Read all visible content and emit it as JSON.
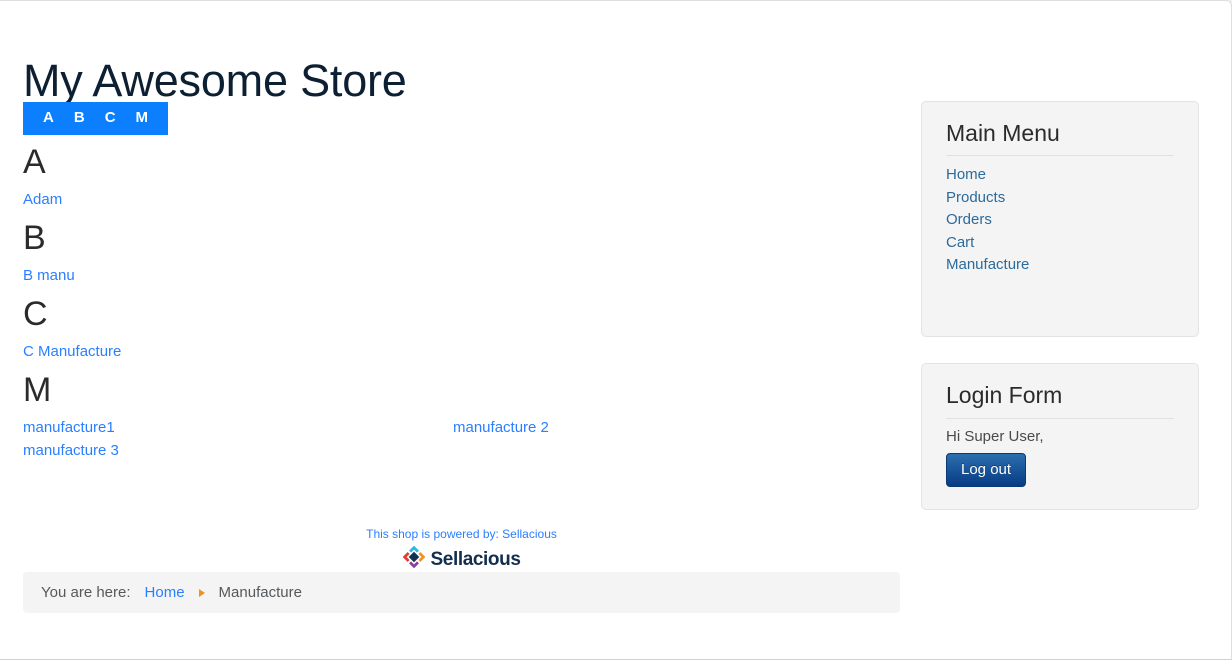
{
  "site": {
    "title": "My Awesome Store"
  },
  "alpha_bar": {
    "letters": [
      {
        "label": "A"
      },
      {
        "label": "B"
      },
      {
        "label": "C"
      },
      {
        "label": "M"
      }
    ]
  },
  "manufacturers": {
    "groups": [
      {
        "letter": "A",
        "items": [
          "Adam"
        ]
      },
      {
        "letter": "B",
        "items": [
          "B manu"
        ]
      },
      {
        "letter": "C",
        "items": [
          "C Manufacture"
        ]
      },
      {
        "letter": "M",
        "items": [
          "manufacture1",
          "manufacture 2",
          "manufacture 3"
        ]
      }
    ]
  },
  "powered_by": {
    "text": "This shop is powered by: Sellacious",
    "brand": "Sellacious",
    "brand_colors": {
      "top": "#2bb8e0",
      "right": "#f2931f",
      "bottom": "#8e3f9e",
      "left": "#e0412f",
      "center": "#13324f"
    }
  },
  "breadcrumb": {
    "label": "You are here:",
    "home": "Home",
    "current": "Manufacture",
    "separator_color": "#f0921e"
  },
  "sidebar": {
    "main_menu": {
      "title": "Main Menu",
      "items": [
        {
          "label": "Home"
        },
        {
          "label": "Products"
        },
        {
          "label": "Orders"
        },
        {
          "label": "Cart"
        },
        {
          "label": "Manufacture"
        }
      ]
    },
    "login_form": {
      "title": "Login Form",
      "greeting": "Hi Super User,",
      "logout_label": "Log out"
    }
  },
  "colors": {
    "accent_blue": "#0b7ffe",
    "link_blue": "#2a7fff",
    "sidebar_link": "#2b6a9b",
    "title_navy": "#0d2033"
  }
}
